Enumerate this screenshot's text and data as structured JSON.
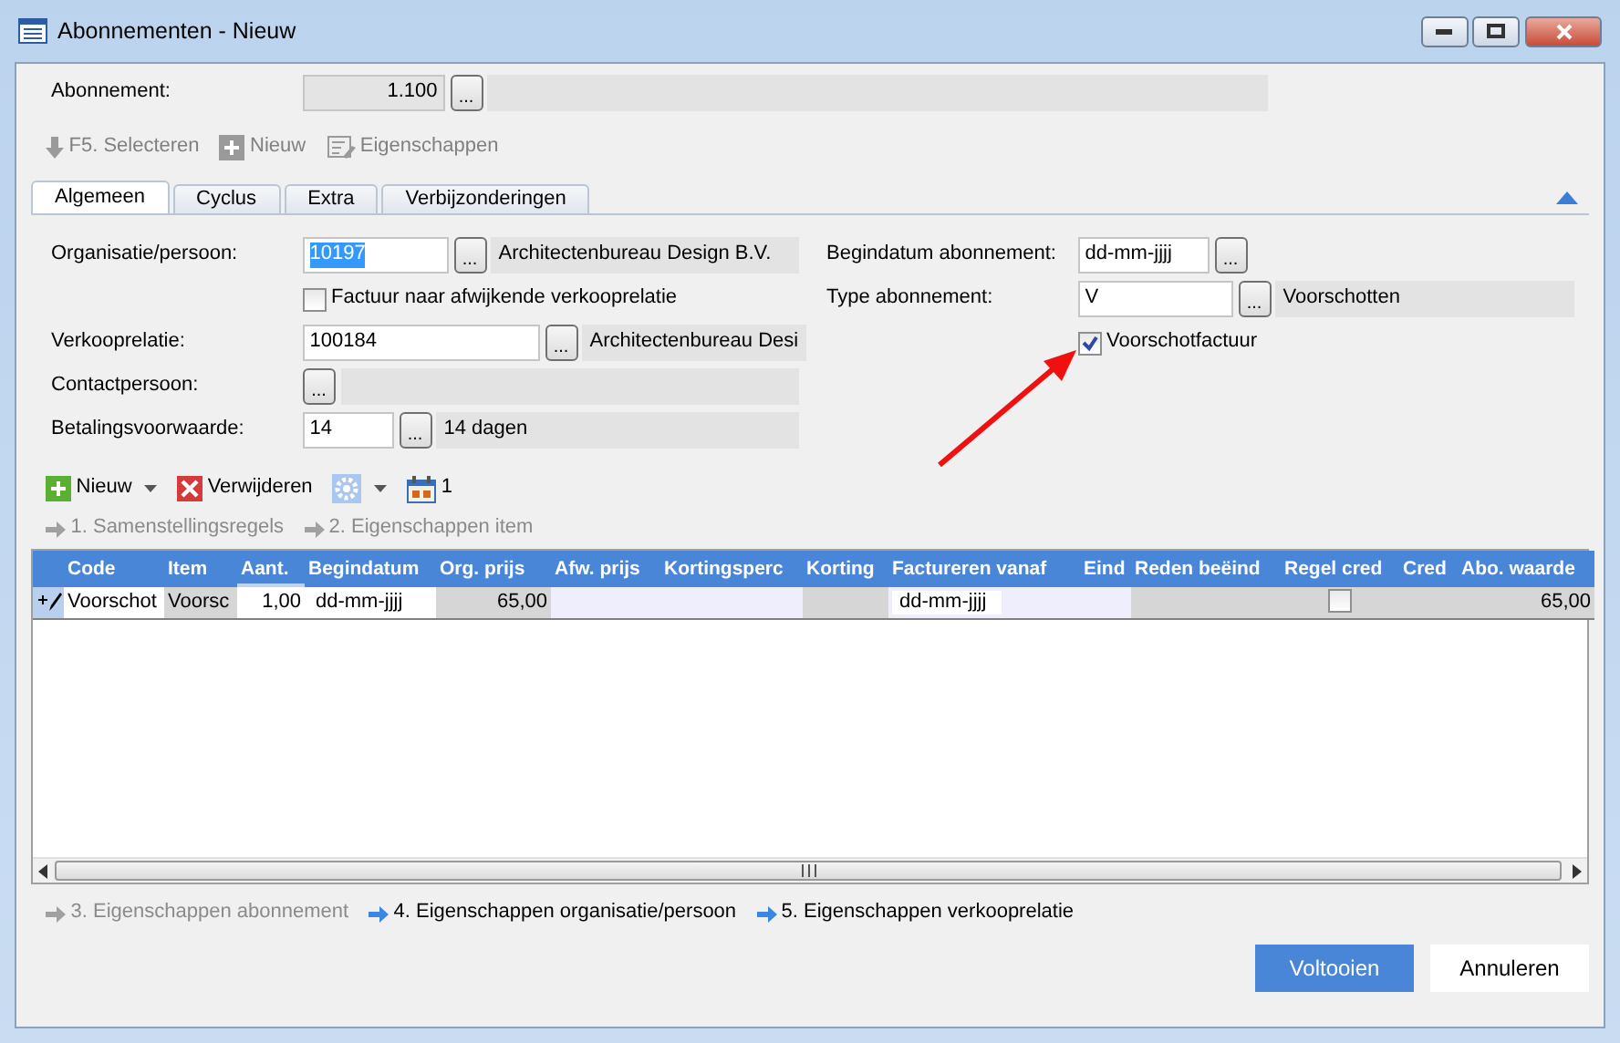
{
  "window": {
    "title": "Abonnementen - Nieuw"
  },
  "header": {
    "label": "Abonnement:",
    "value": "1.100",
    "button": "..."
  },
  "toolbar": [
    {
      "kind": "select",
      "label": "F5. Selecteren",
      "disabled": true
    },
    {
      "kind": "new",
      "label": "Nieuw",
      "disabled": true
    },
    {
      "kind": "properties",
      "label": "Eigenschappen",
      "disabled": true
    }
  ],
  "tabs": [
    {
      "label": "Algemeen",
      "selected": true
    },
    {
      "label": "Cyclus",
      "selected": false
    },
    {
      "label": "Extra",
      "selected": false
    },
    {
      "label": "Verbijzonderingen",
      "selected": false
    }
  ],
  "form_left": [
    {
      "kind": "lookup",
      "label": "Organisatie/persoon:",
      "value": "10197",
      "value_selected": true,
      "button": "...",
      "description": "Architectenbureau Design B.V."
    },
    {
      "kind": "checkbox",
      "label": "Factuur naar afwijkende verkooprelatie",
      "checked": false
    },
    {
      "kind": "lookup",
      "label": "Verkooprelatie:",
      "value": "100184",
      "value_selected": false,
      "button": "...",
      "description": "Architectenbureau Desi"
    },
    {
      "kind": "lookup",
      "label": "Contactpersoon:",
      "button": "..."
    },
    {
      "kind": "lookup",
      "label": "Betalingsvoorwaarde:",
      "value": "14",
      "value_selected": false,
      "button": "...",
      "description": "14 dagen"
    }
  ],
  "form_right": [
    {
      "kind": "date",
      "label": "Begindatum abonnement:",
      "value": "dd-mm-jjjj",
      "value_selected": false,
      "button": "..."
    },
    {
      "kind": "lookup",
      "label": "Type abonnement:",
      "value": "V",
      "value_selected": false,
      "button": "...",
      "description": "Voorschotten"
    },
    {
      "kind": "checkbox",
      "label": "Voorschotfactuur",
      "checked": true
    }
  ],
  "grid_toolbar": [
    {
      "kind": "new",
      "label": "Nieuw",
      "dropdown": true
    },
    {
      "kind": "delete",
      "label": "Verwijderen",
      "dropdown": false
    },
    {
      "kind": "settings",
      "dropdown": true
    },
    {
      "kind": "calendar",
      "label": "1",
      "dropdown": false
    }
  ],
  "steps_top": [
    {
      "label": "1. Samenstellingsregels",
      "disabled": true
    },
    {
      "label": "2. Eigenschappen item",
      "disabled": true
    }
  ],
  "table": {
    "columns": [
      "Code",
      "Item",
      "Aant.",
      "Begindatum",
      "Org. prijs",
      "Afw. prijs",
      "Kortingsperc",
      "Korting",
      "Factureren vanaf",
      "Eind",
      "Reden beëind",
      "Regel cred",
      "Cred",
      "Abo. waarde"
    ],
    "rows": [
      {
        "cells": [
          {
            "kind": "text",
            "text": "Voorschot"
          },
          {
            "kind": "text",
            "text": "Voorsc"
          },
          {
            "kind": "text",
            "text": "1,00"
          },
          {
            "kind": "date",
            "text": "dd-mm-jjjj"
          },
          {
            "kind": "text",
            "text": "65,00"
          },
          {
            "kind": "empty"
          },
          {
            "kind": "empty"
          },
          {
            "kind": "empty"
          },
          {
            "kind": "date",
            "text": "dd-mm-jjjj"
          },
          {
            "kind": "empty"
          },
          {
            "kind": "empty"
          },
          {
            "kind": "checkbox",
            "checked": false
          },
          {
            "kind": "empty"
          },
          {
            "kind": "text",
            "text": "65,00"
          }
        ]
      }
    ]
  },
  "steps_bottom": [
    {
      "label": "3. Eigenschappen abonnement",
      "disabled": true
    },
    {
      "label": "4. Eigenschappen organisatie/persoon",
      "disabled": false
    },
    {
      "label": "5. Eigenschappen verkooprelatie",
      "disabled": false
    }
  ],
  "buttons": [
    {
      "label": "Voltooien",
      "primary": true
    },
    {
      "label": "Annuleren",
      "primary": false
    }
  ]
}
